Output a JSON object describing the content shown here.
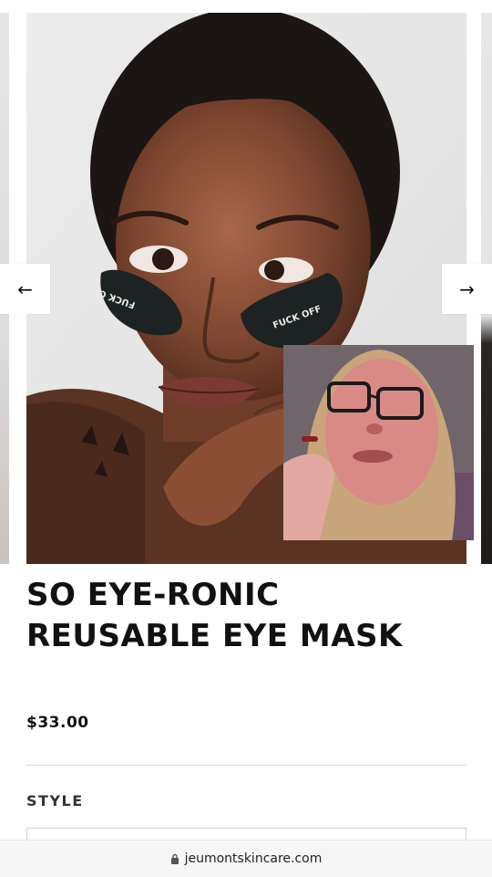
{
  "carousel": {
    "prev_arrow": "←",
    "next_arrow": "→",
    "patch_left_text": "FUCK OFF",
    "patch_right_text": "FUCK OFF"
  },
  "product": {
    "title": "SO EYE-RONIC REUSABLE EYE MASK",
    "price": "$33.00",
    "option_label": "STYLE"
  },
  "browser": {
    "url": "jeumontskincare.com"
  },
  "colors": {
    "text": "#111111",
    "patch": "#1d2322",
    "photo_bg": "#e9e9ea"
  }
}
